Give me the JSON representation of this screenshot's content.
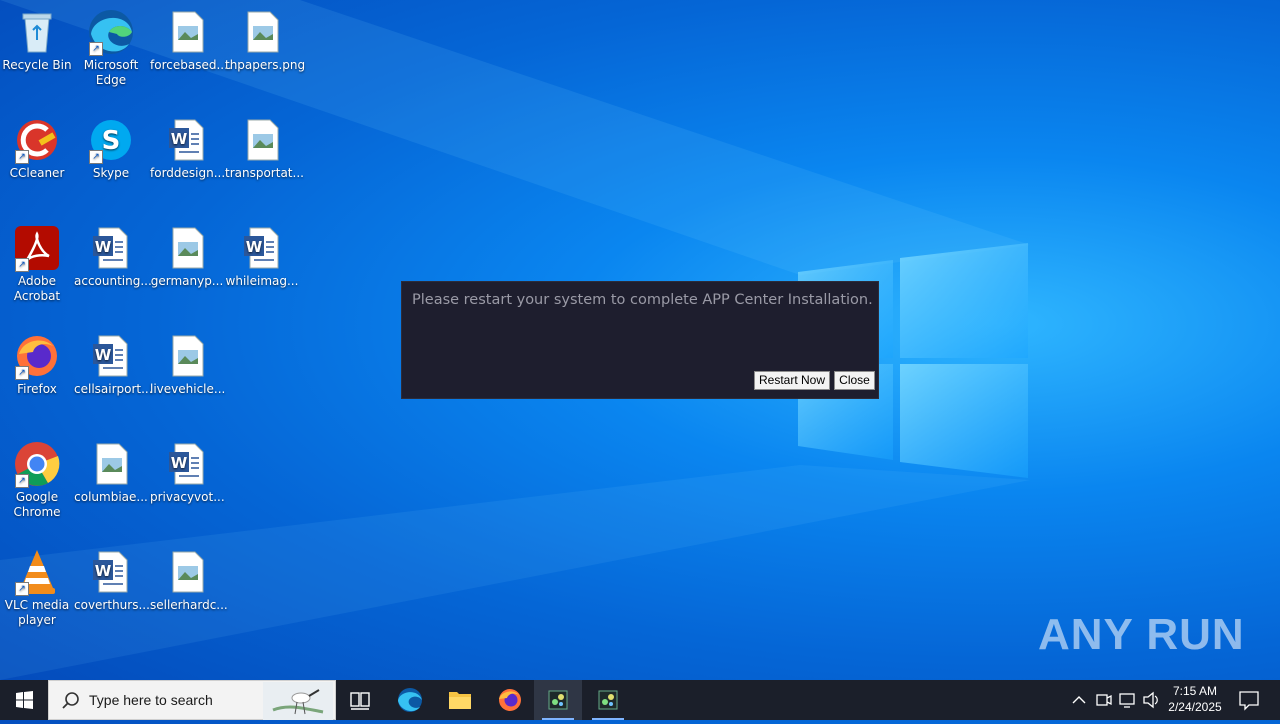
{
  "desktop": {
    "icons": [
      {
        "label": "Recycle Bin"
      },
      {
        "label": "Microsoft Edge"
      },
      {
        "label": "forcebased...."
      },
      {
        "label": "thpapers.png"
      },
      {
        "label": "CCleaner"
      },
      {
        "label": "Skype"
      },
      {
        "label": "forddesign..."
      },
      {
        "label": "transportat..."
      },
      {
        "label": "Adobe Acrobat"
      },
      {
        "label": "accounting..."
      },
      {
        "label": "germanyp..."
      },
      {
        "label": "whileimag..."
      },
      {
        "label": "Firefox"
      },
      {
        "label": "cellsairport..."
      },
      {
        "label": "livevehicle..."
      },
      {
        "label": "Google Chrome"
      },
      {
        "label": "columbiae..."
      },
      {
        "label": "privacyvot..."
      },
      {
        "label": "VLC media player"
      },
      {
        "label": "coverthurs..."
      },
      {
        "label": "sellerhardc..."
      }
    ]
  },
  "dialog": {
    "message": "Please restart your system to complete APP Center Installation.",
    "restart_label": "Restart Now",
    "close_label": "Close"
  },
  "taskbar": {
    "search_placeholder": "Type here to search",
    "apps": [
      "task-view",
      "edge",
      "file-explorer",
      "firefox",
      "app-center",
      "app-center-2"
    ],
    "time": "7:15 AM",
    "date": "2/24/2025"
  },
  "watermark": "ANY RUN",
  "colors": {
    "dialog_bg": "#1e1e2e",
    "taskbar_bg": "#1b1f2a",
    "desktop_accent": "#0a86f0"
  }
}
